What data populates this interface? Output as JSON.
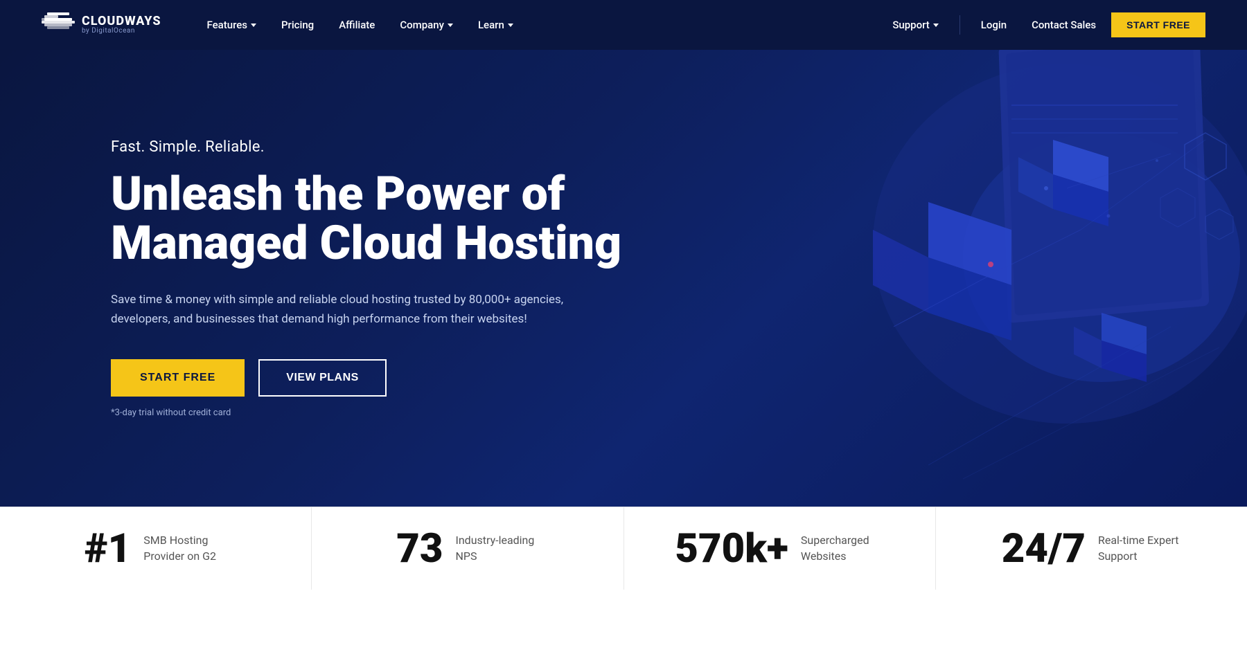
{
  "brand": {
    "name": "CLOUDWAYS",
    "sub": "by DigitalOcean"
  },
  "nav": {
    "links": [
      {
        "label": "Features",
        "hasDropdown": true
      },
      {
        "label": "Pricing",
        "hasDropdown": false
      },
      {
        "label": "Affiliate",
        "hasDropdown": false
      },
      {
        "label": "Company",
        "hasDropdown": true
      },
      {
        "label": "Learn",
        "hasDropdown": true
      }
    ],
    "right": [
      {
        "label": "Support",
        "hasDropdown": true
      },
      {
        "label": "Login"
      },
      {
        "label": "Contact Sales"
      }
    ],
    "cta": "START FREE"
  },
  "hero": {
    "tagline": "Fast. Simple. Reliable.",
    "headline_line1": "Unleash the Power of",
    "headline_line2": "Managed Cloud Hosting",
    "description": "Save time & money with simple and reliable cloud hosting trusted by 80,000+ agencies, developers, and businesses that demand high performance from their websites!",
    "btn_start": "START FREE",
    "btn_plans": "VIEW PLANS",
    "trial_text": "*3-day trial without credit card"
  },
  "stats": [
    {
      "number": "#1",
      "label": "SMB Hosting Provider on G2"
    },
    {
      "number": "73",
      "label": "Industry-leading NPS"
    },
    {
      "number": "570k+",
      "label": "Supercharged Websites"
    },
    {
      "number": "24/7",
      "label": "Real-time Expert Support"
    }
  ]
}
